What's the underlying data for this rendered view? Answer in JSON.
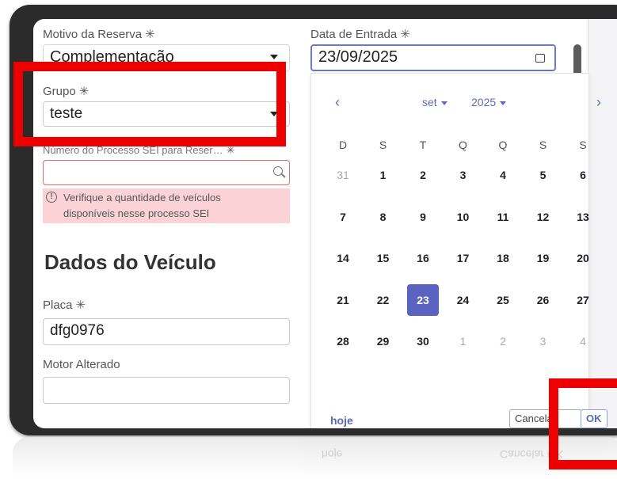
{
  "form": {
    "motivo": {
      "label": "Motivo da Reserva",
      "value": "Complementação"
    },
    "grupo": {
      "label": "Grupo",
      "value": "teste"
    },
    "sei": {
      "label": "Número do Processo SEI para Reser…",
      "value": "",
      "warning_line1": "Verifique a quantidade de veículos",
      "warning_line2": "disponíveis nesse processo SEI"
    },
    "section_title": "Dados do Veículo",
    "placa": {
      "label": "Placa",
      "value": "dfg0976"
    },
    "motor": {
      "label": "Motor Alterado",
      "value": ""
    },
    "data_entrada": {
      "label": "Data de Entrada",
      "value": "23/09/2025"
    },
    "required_mark": "✳"
  },
  "calendar": {
    "prev": "‹",
    "next": "›",
    "month": "set",
    "year": "2025",
    "weekdays": [
      "D",
      "S",
      "T",
      "Q",
      "Q",
      "S",
      "S"
    ],
    "weeks": [
      [
        {
          "d": "31",
          "m": true
        },
        {
          "d": "1"
        },
        {
          "d": "2"
        },
        {
          "d": "3"
        },
        {
          "d": "4"
        },
        {
          "d": "5"
        },
        {
          "d": "6"
        }
      ],
      [
        {
          "d": "7"
        },
        {
          "d": "8"
        },
        {
          "d": "9"
        },
        {
          "d": "10"
        },
        {
          "d": "11"
        },
        {
          "d": "12"
        },
        {
          "d": "13"
        }
      ],
      [
        {
          "d": "14"
        },
        {
          "d": "15"
        },
        {
          "d": "16"
        },
        {
          "d": "17"
        },
        {
          "d": "18"
        },
        {
          "d": "19"
        },
        {
          "d": "20"
        }
      ],
      [
        {
          "d": "21"
        },
        {
          "d": "22"
        },
        {
          "d": "23",
          "sel": true
        },
        {
          "d": "24"
        },
        {
          "d": "25"
        },
        {
          "d": "26"
        },
        {
          "d": "27"
        }
      ],
      [
        {
          "d": "28"
        },
        {
          "d": "29"
        },
        {
          "d": "30"
        },
        {
          "d": "1",
          "m": true
        },
        {
          "d": "2",
          "m": true
        },
        {
          "d": "3",
          "m": true
        },
        {
          "d": "4",
          "m": true
        }
      ]
    ],
    "today_label": "hoje",
    "cancel_label": "Cancelar",
    "ok_label": "OK"
  },
  "colors": {
    "highlight": "#ee0000",
    "accent": "#5b63c1",
    "warning_bg": "#fbd3d6"
  }
}
